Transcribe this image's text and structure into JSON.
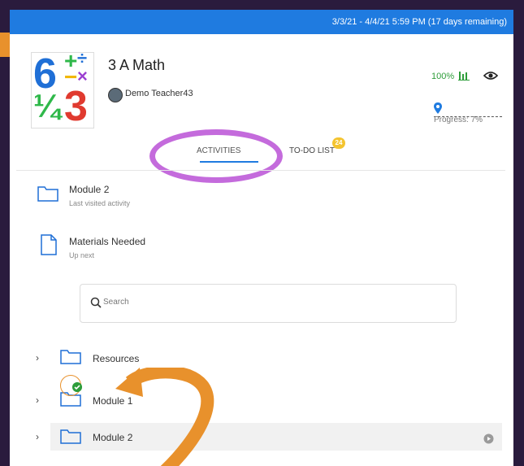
{
  "header": {
    "date_range": "3/3/21 - 4/4/21 5:59 PM (17 days remaining)"
  },
  "course": {
    "title": "3 A Math",
    "teacher": "Demo Teacher43",
    "logo_glyphs": [
      "6",
      "+",
      "÷",
      "−",
      "×",
      "¼",
      "3"
    ]
  },
  "stats": {
    "percent": "100%",
    "progress_label": "Progress: 7%",
    "progress_value": 0.07
  },
  "tabs": [
    {
      "label": "ACTIVITIES",
      "active": true
    },
    {
      "label": "TO-DO LIST",
      "badge": "24"
    }
  ],
  "recent": [
    {
      "title": "Module 2",
      "subtitle": "Last visited activity",
      "icon": "folder-icon"
    },
    {
      "title": "Materials Needed",
      "subtitle": "Up next",
      "icon": "document-icon"
    }
  ],
  "search": {
    "placeholder": "Search"
  },
  "tree": [
    {
      "label": "Resources",
      "icon": "folder-icon"
    },
    {
      "label": "Module 1",
      "icon": "folder-icon",
      "completed": true
    },
    {
      "label": "Module 2",
      "icon": "folder-icon",
      "current": true
    }
  ],
  "colors": {
    "accent": "#1f7be0",
    "highlight_ellipse": "#c46bdc",
    "annotation_arrow": "#e8912c",
    "success": "#2e9d3a",
    "badge": "#f4c430"
  }
}
